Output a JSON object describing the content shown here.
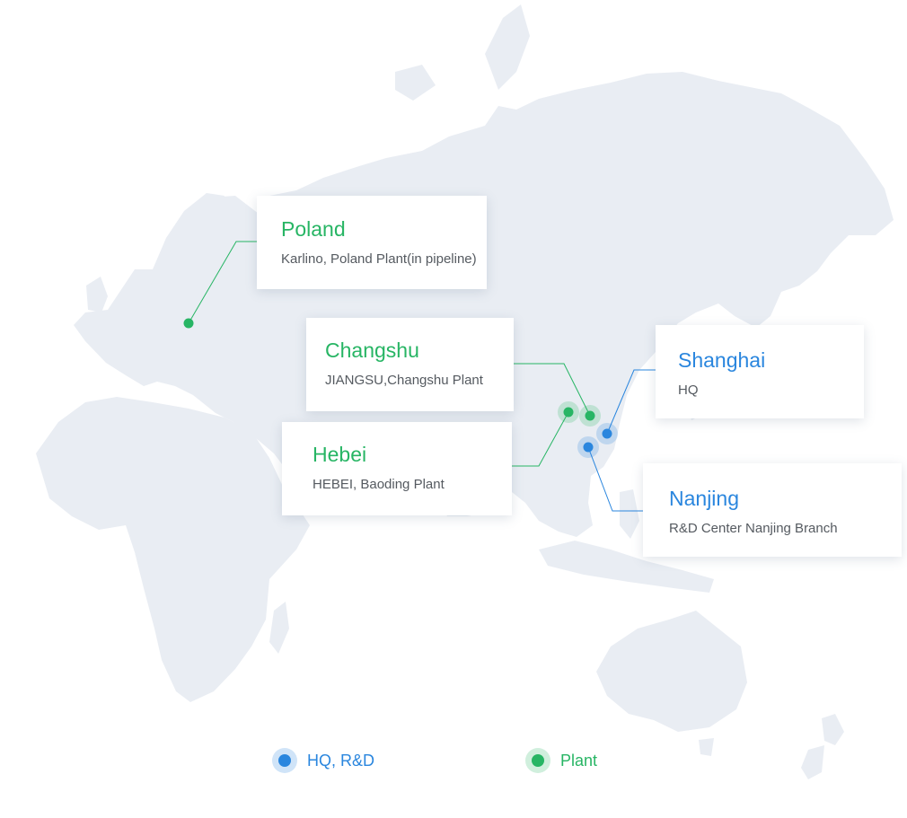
{
  "colors": {
    "plant": "#27b564",
    "hq_rd": "#2a86de",
    "land": "#e9edf3",
    "card_description": "#555a60"
  },
  "locations": [
    {
      "id": "poland",
      "title": "Poland",
      "description": "Karlino, Poland Plant(in pipeline)",
      "category": "plant"
    },
    {
      "id": "changshu",
      "title": "Changshu",
      "description": "JIANGSU,Changshu Plant",
      "category": "plant"
    },
    {
      "id": "hebei",
      "title": "Hebei",
      "description": "HEBEI, Baoding Plant",
      "category": "plant"
    },
    {
      "id": "shanghai",
      "title": "Shanghai",
      "description": "HQ",
      "category": "hq_rd"
    },
    {
      "id": "nanjing",
      "title": "Nanjing",
      "description": "R&D Center Nanjing Branch",
      "category": "hq_rd"
    }
  ],
  "legend": [
    {
      "id": "hq_rd",
      "label": "HQ, R&D",
      "icon": "blue-dot-icon"
    },
    {
      "id": "plant",
      "label": "Plant",
      "icon": "green-dot-icon"
    }
  ]
}
